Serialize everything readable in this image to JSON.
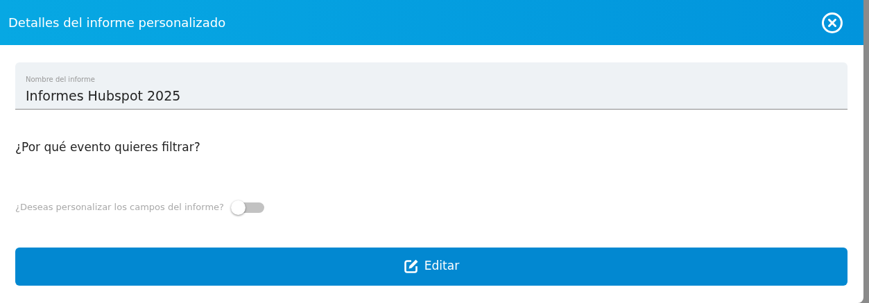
{
  "window": {
    "title": "Detalles del informe personalizado"
  },
  "report_name": {
    "label": "Nombre del informe",
    "value": "Informes Hubspot 2025"
  },
  "question": "¿Por qué evento quieres filtrar?",
  "customize_fields": {
    "label": "¿Deseas personalizar los campos del informe?",
    "on": false
  },
  "edit_button": {
    "label": "Editar"
  }
}
